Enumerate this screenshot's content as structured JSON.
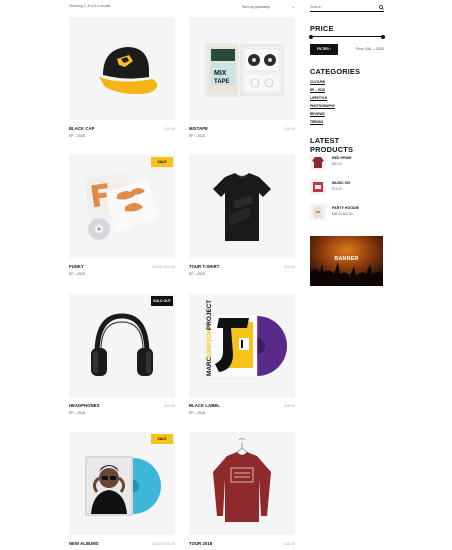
{
  "toolbar": {
    "results_text": "Showing 1–8 of 14 results",
    "sort_value": "Sort by popularity"
  },
  "products": [
    {
      "name": "BLACK CAP",
      "category": "EP – 2018",
      "price": "$13.00"
    },
    {
      "name": "MIXTAPE",
      "category": "EP – 2018",
      "price": "$18.00"
    },
    {
      "name": "FUNKY",
      "category": "EP – 2018",
      "price": "$18.00 $12.00",
      "badge": "SALE"
    },
    {
      "name": "TOUR T-SHIRT",
      "category": "EP – 2018",
      "price": "$15.00"
    },
    {
      "name": "HEADPHONES",
      "category": "EP – 2018",
      "price": "$14.00",
      "badge": "SOLD OUT"
    },
    {
      "name": "BLACK LABEL",
      "category": "EP – 2018",
      "price": "$18.00"
    },
    {
      "name": "NEW ALBUMS",
      "category": "EP – 2018",
      "price": "$38.00 $26.00",
      "badge": "SALE"
    },
    {
      "name": "TOUR 2018",
      "category": "EP – 2018",
      "price": "$18.00"
    }
  ],
  "sidebar": {
    "search_placeholder": "Search",
    "price_title": "PRICE",
    "filter_label": "FILTER ›",
    "price_range": "Price: $16 — $100",
    "categories_title": "CATEGORIES",
    "categories": [
      "CULTURE",
      "EP – 2018",
      "LIFESTYLE",
      "PHOTOGRAPHY",
      "REVIEWS",
      "TRENDS"
    ],
    "latest_title": "LATEST PRODUCTS",
    "latest": [
      {
        "name": "RED PRIDE",
        "price": "$40.00"
      },
      {
        "name": "MUSIC ON",
        "price": "$74.00"
      },
      {
        "name": "PARTY HOODIE",
        "price": "$48.00 $42.00"
      }
    ],
    "banner_label": "BANNER"
  },
  "colors": {
    "accent_yellow": "#f7c31a",
    "black": "#111111",
    "tee_red": "#8e2a2b",
    "vinyl_blue": "#3db7d8",
    "vinyl_purple": "#5a2a8a"
  }
}
